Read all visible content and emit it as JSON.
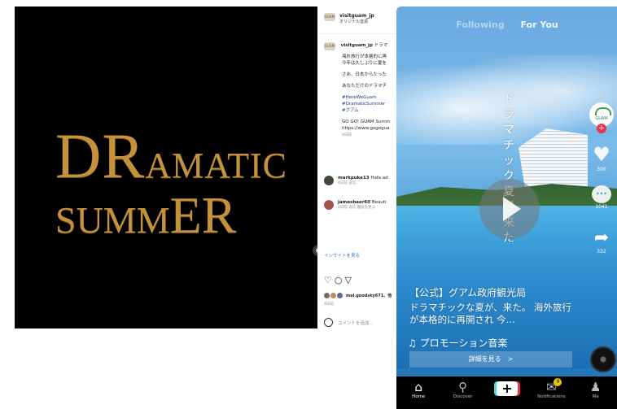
{
  "instagram": {
    "image_title": {
      "line1_big": "DR",
      "line1_small": "AMATIC",
      "line2_small": "SUMM",
      "line2_big": "ER"
    },
    "header": {
      "username": "visitguam_jp",
      "subtitle": "オリジナル音源",
      "avatar_label": "GUAM"
    },
    "caption": {
      "username": "visitguam_jp",
      "lead": "ドラマ",
      "paragraphs": [
        "海外旅行が本格的に再",
        "今年は久しぶりに夏を",
        "さあ、日本からたった",
        "あなただけのドラマチ"
      ],
      "hashtags": [
        "#HereWeGuam",
        "#DramaticSummer",
        "#グアム"
      ],
      "link_lines": [
        "GO GO! GUAM Summ",
        "https://www.gogogua"
      ],
      "date": "4日前"
    },
    "comments": [
      {
        "username": "markpuke13",
        "text": "Hafa ad",
        "meta": "4日前  返信"
      },
      {
        "username": "jamesbaer60",
        "text": "Beauti",
        "meta": "4日前  返信  翻訳を見る"
      }
    ],
    "insight_link": "インサイトを見る",
    "liked_by": "mai.goodsky671、他",
    "post_date": "4日前",
    "add_comment_placeholder": "コメントを追加..."
  },
  "tiktok": {
    "tabs": {
      "following": "Following",
      "for_you": "For You"
    },
    "vertical_caption": "ドラマチック夏が、来た",
    "side": {
      "brand": "GUAM",
      "like_count": "300",
      "comment_count": "1041",
      "share_count": "332"
    },
    "account_name": "【公式】グアム政府観光局",
    "description": "ドラマチックな夏が、来た。 海外旅行が本格的に再開され 今...",
    "music": "♫ プロモーション音楽",
    "details_button": "詳細を見る　>",
    "nav": {
      "home": "Home",
      "discover": "Discover",
      "notifications": "Notifications",
      "notif_badge": "9",
      "me": "Me"
    }
  }
}
